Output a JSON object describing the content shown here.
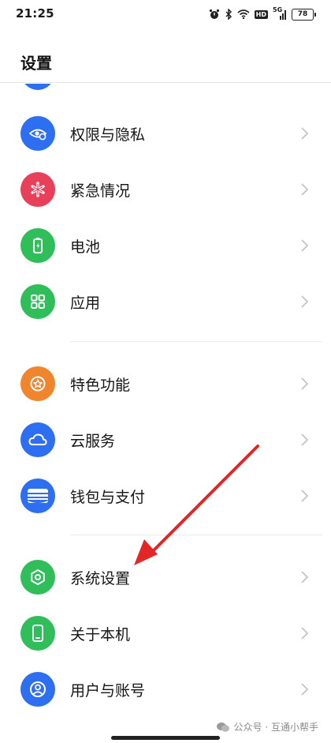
{
  "status_bar": {
    "time": "21:25",
    "network": "5G",
    "hd": "HD",
    "battery": "78"
  },
  "header": {
    "title": "设置"
  },
  "colors": {
    "blue": "#2e6ef0",
    "red": "#e8405a",
    "green": "#2fbe5a",
    "orange": "#f0852e",
    "arrow": "#e32626"
  },
  "items": [
    {
      "label": "权限与隐私",
      "icon": "eye-shield-icon",
      "color": "#2e6ef0"
    },
    {
      "label": "紧急情况",
      "icon": "asterisk-icon",
      "color": "#e8405a"
    },
    {
      "label": "电池",
      "icon": "battery-icon",
      "color": "#2fbe5a"
    },
    {
      "label": "应用",
      "icon": "grid-icon",
      "color": "#2fbe5a"
    },
    {
      "label": "特色功能",
      "icon": "star-icon",
      "color": "#f0852e"
    },
    {
      "label": "云服务",
      "icon": "cloud-icon",
      "color": "#2e6ef0"
    },
    {
      "label": "钱包与支付",
      "icon": "wallet-icon",
      "color": "#2e6ef0"
    },
    {
      "label": "系统设置",
      "icon": "hexagon-gear-icon",
      "color": "#2fbe5a"
    },
    {
      "label": "关于本机",
      "icon": "phone-icon",
      "color": "#2fbe5a"
    },
    {
      "label": "用户与账号",
      "icon": "user-icon",
      "color": "#2e6ef0"
    }
  ],
  "watermark": {
    "text": "公众号 · 互通小帮手"
  }
}
